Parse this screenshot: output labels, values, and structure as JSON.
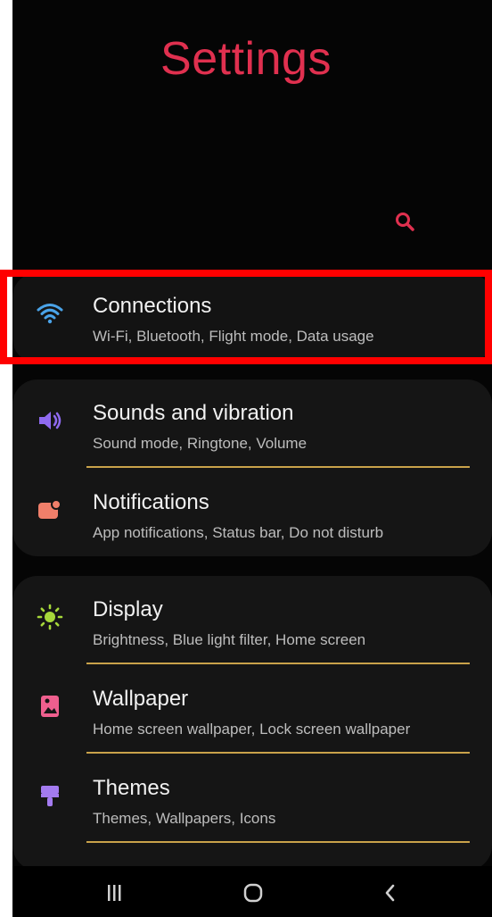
{
  "header": {
    "title": "Settings"
  },
  "colors": {
    "accent": "#e0304f",
    "divider": "#c9a24a",
    "highlight": "#ff0000"
  },
  "items": [
    {
      "label": "Connections",
      "sub": "Wi-Fi, Bluetooth, Flight mode, Data usage",
      "icon": "wifi-icon"
    },
    {
      "label": "Sounds and vibration",
      "sub": "Sound mode, Ringtone, Volume",
      "icon": "speaker-icon"
    },
    {
      "label": "Notifications",
      "sub": "App notifications, Status bar, Do not disturb",
      "icon": "notification-icon"
    },
    {
      "label": "Display",
      "sub": "Brightness, Blue light filter, Home screen",
      "icon": "sun-icon"
    },
    {
      "label": "Wallpaper",
      "sub": "Home screen wallpaper, Lock screen wallpaper",
      "icon": "wallpaper-icon"
    },
    {
      "label": "Themes",
      "sub": "Themes, Wallpapers, Icons",
      "icon": "brush-icon"
    }
  ],
  "navbar": {
    "recents": "recent-apps-icon",
    "home": "home-icon",
    "back": "back-icon"
  }
}
